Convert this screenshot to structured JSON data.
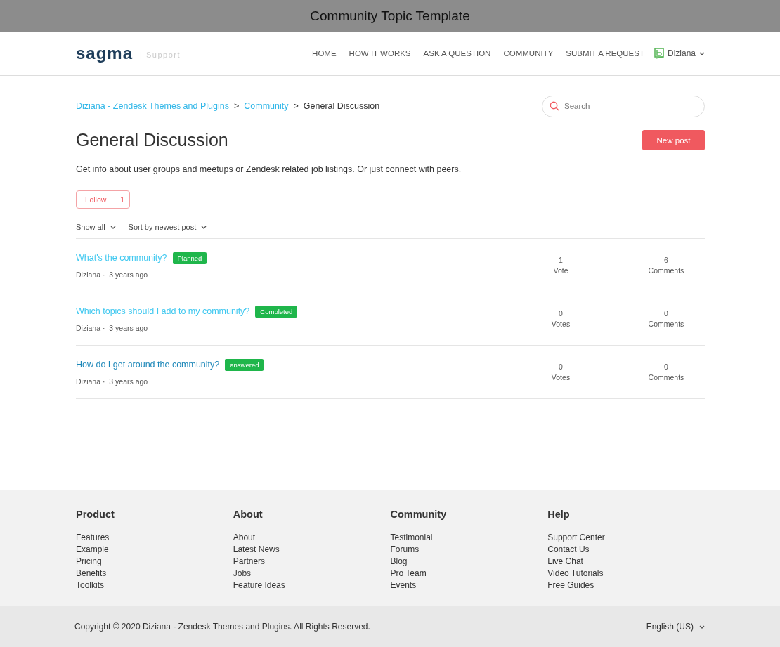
{
  "window": {
    "title": "Community Topic Template"
  },
  "header": {
    "logo": "sagma",
    "logo_caption": "| Support",
    "nav": [
      "HOME",
      "HOW IT WORKS",
      "ASK A QUESTION",
      "COMMUNITY",
      "SUBMIT A REQUEST"
    ],
    "user": "Diziana"
  },
  "breadcrumbs": [
    {
      "label": "Diziana - Zendesk Themes and Plugins",
      "link": true
    },
    {
      "label": ">",
      "link": false
    },
    {
      "label": "Community",
      "link": true
    },
    {
      "label": ">",
      "link": false
    },
    {
      "label": "General Discussion",
      "link": false
    }
  ],
  "search": {
    "placeholder": "Search"
  },
  "topic": {
    "title": "General Discussion",
    "new_post": "New post",
    "description": "Get info about user groups and meetups or Zendesk related job listings. Or just connect with peers.",
    "follow": "Follow",
    "follow_count": "1"
  },
  "filters": [
    "Show all",
    "Sort by newest post"
  ],
  "posts": [
    {
      "title": "What's the community?",
      "visited": false,
      "status": "Planned",
      "author": "Diziana",
      "separator": "·",
      "time": "3 years ago",
      "votes": "1",
      "votes_label": "Vote",
      "comments": "6",
      "comments_label": "Comments"
    },
    {
      "title": "Which topics should I add to my community?",
      "visited": false,
      "status": "Completed",
      "author": "Diziana",
      "separator": "·",
      "time": "3 years ago",
      "votes": "0",
      "votes_label": "Votes",
      "comments": "0",
      "comments_label": "Comments"
    },
    {
      "title": "How do I get around the community?",
      "visited": true,
      "status": "answered",
      "author": "Diziana",
      "separator": "·",
      "time": "3 years ago",
      "votes": "0",
      "votes_label": "Votes",
      "comments": "0",
      "comments_label": "Comments"
    }
  ],
  "footer": {
    "columns": [
      {
        "heading": "Product",
        "links": [
          "Features",
          "Example",
          "Pricing",
          "Benefits",
          "Toolkits"
        ]
      },
      {
        "heading": "About",
        "links": [
          "About",
          "Latest News",
          "Partners",
          "Jobs",
          "Feature Ideas"
        ]
      },
      {
        "heading": "Community",
        "links": [
          "Testimonial",
          "Forums",
          "Blog",
          "Pro Team",
          "Events"
        ]
      },
      {
        "heading": "Help",
        "links": [
          "Support Center",
          "Contact Us",
          "Live Chat",
          "Video Tutorials",
          "Free Guides"
        ]
      }
    ],
    "copyright": "Copyright © 2020 Diziana - Zendesk Themes and Plugins. All Rights Reserved.",
    "language": "English (US)"
  }
}
